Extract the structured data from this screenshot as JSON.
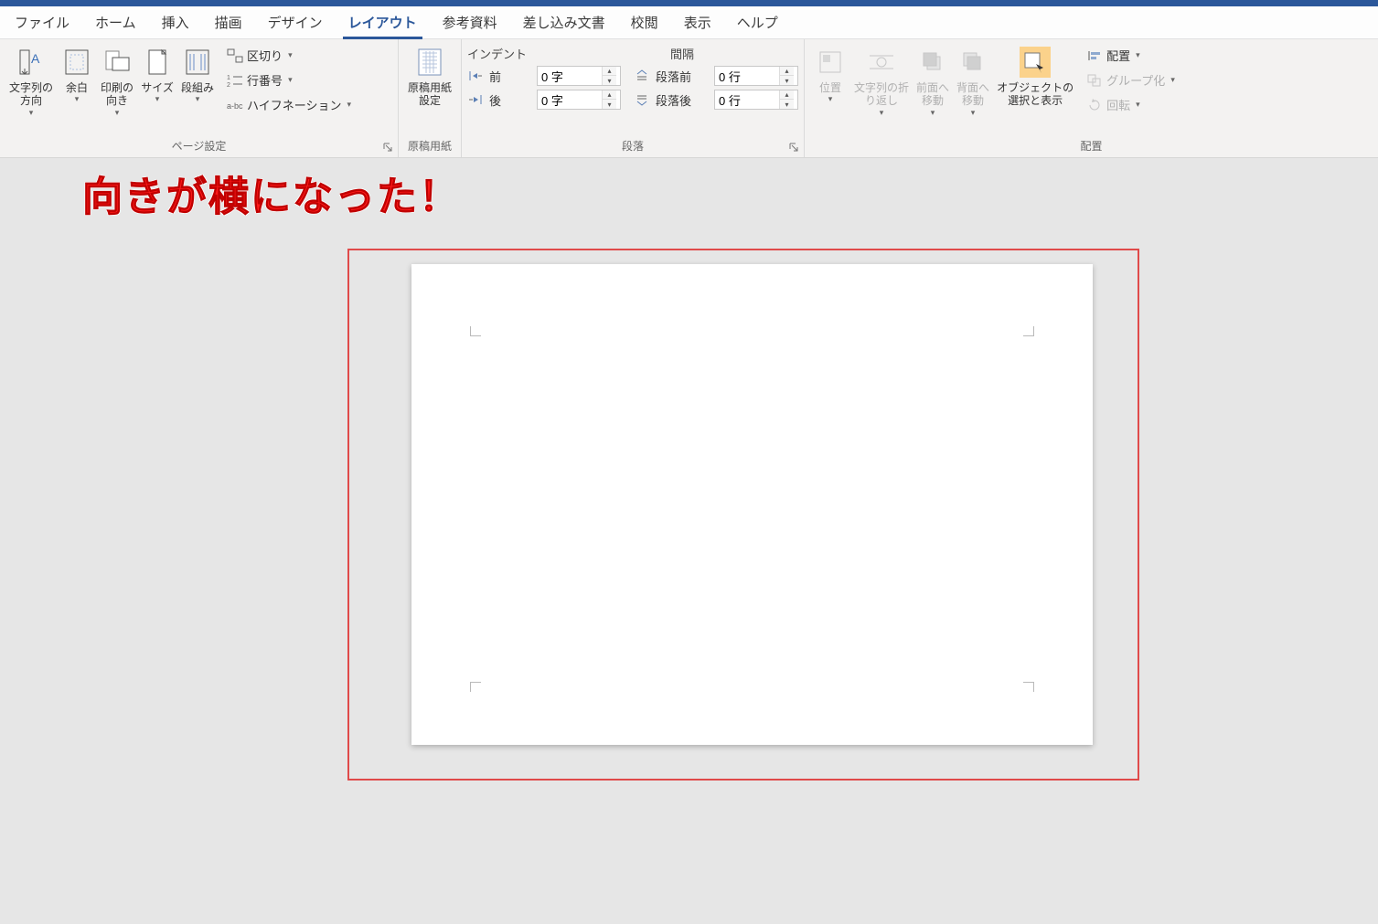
{
  "tabs": {
    "file": "ファイル",
    "home": "ホーム",
    "insert": "挿入",
    "draw": "描画",
    "design": "デザイン",
    "layout": "レイアウト",
    "references": "参考資料",
    "mailings": "差し込み文書",
    "review": "校閲",
    "view": "表示",
    "help": "ヘルプ"
  },
  "active_tab": "layout",
  "page_setup": {
    "group_label": "ページ設定",
    "text_direction": "文字列の\n方向",
    "margins": "余白",
    "orientation": "印刷の\n向き",
    "size": "サイズ",
    "columns": "段組み",
    "breaks": "区切り",
    "line_numbers": "行番号",
    "hyphenation": "ハイフネーション"
  },
  "genko": {
    "group_label": "原稿用紙",
    "button": "原稿用紙\n設定"
  },
  "paragraph": {
    "group_label": "段落",
    "indent_header": "インデント",
    "spacing_header": "間隔",
    "left_label": "前",
    "right_label": "後",
    "before_label": "段落前",
    "after_label": "段落後",
    "left_value": "0 字",
    "right_value": "0 字",
    "before_value": "0 行",
    "after_value": "0 行"
  },
  "arrange": {
    "group_label": "配置",
    "position": "位置",
    "wrap": "文字列の折\nり返し",
    "bring_forward": "前面へ\n移動",
    "send_backward": "背面へ\n移動",
    "selection_pane": "オブジェクトの\n選択と表示",
    "align": "配置",
    "group": "グループ化",
    "rotate": "回転"
  },
  "annotation_text": "向きが横になった！"
}
